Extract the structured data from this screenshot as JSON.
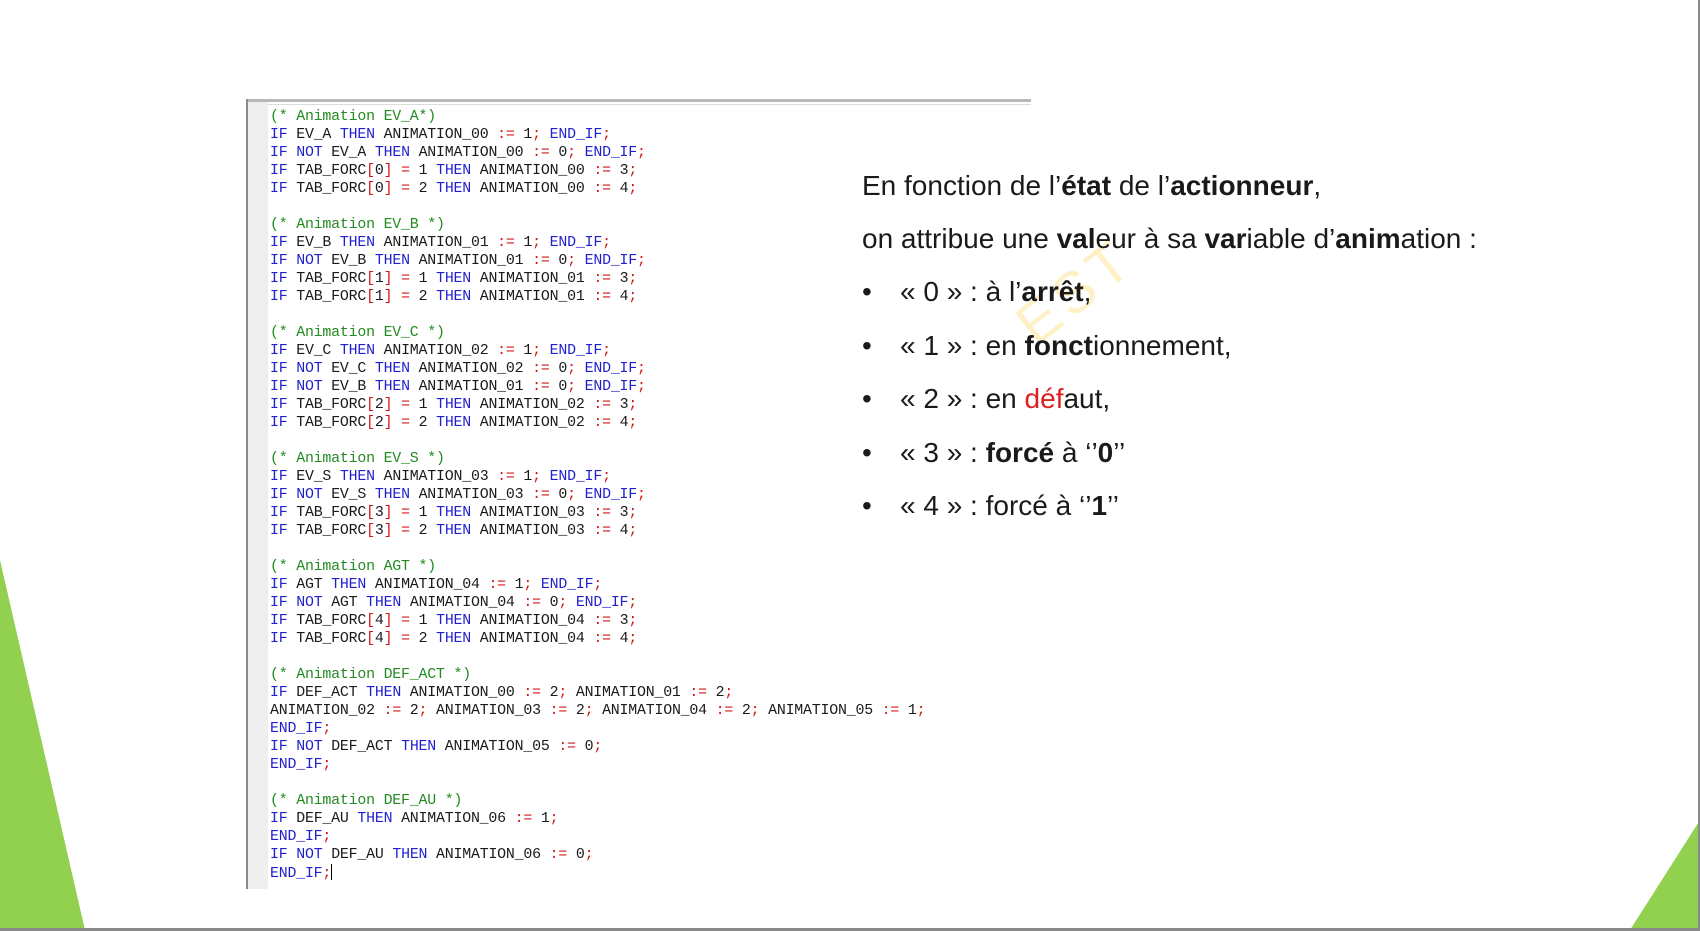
{
  "colors": {
    "keyword": "#1f1fd0",
    "operator": "#d01818",
    "comment": "#228b22",
    "accent_green": "#92d050",
    "defaut_red": "#e02020"
  },
  "code_lines": [
    [
      [
        "cm",
        "(* Animation EV_A*)"
      ]
    ],
    [
      [
        "kw",
        "IF"
      ],
      [
        "id",
        " EV_A "
      ],
      [
        "kw",
        "THEN"
      ],
      [
        "id",
        " ANIMATION_00 "
      ],
      [
        "op",
        ":="
      ],
      [
        "id",
        " 1"
      ],
      [
        "op",
        ";"
      ],
      [
        "id",
        " "
      ],
      [
        "kw",
        "END_IF"
      ],
      [
        "op",
        ";"
      ]
    ],
    [
      [
        "kw",
        "IF"
      ],
      [
        "id",
        " "
      ],
      [
        "kw",
        "NOT"
      ],
      [
        "id",
        " EV_A "
      ],
      [
        "kw",
        "THEN"
      ],
      [
        "id",
        " ANIMATION_00 "
      ],
      [
        "op",
        ":="
      ],
      [
        "id",
        " 0"
      ],
      [
        "op",
        ";"
      ],
      [
        "id",
        " "
      ],
      [
        "kw",
        "END_IF"
      ],
      [
        "op",
        ";"
      ]
    ],
    [
      [
        "kw",
        "IF"
      ],
      [
        "id",
        " TAB_FORC"
      ],
      [
        "op",
        "["
      ],
      [
        "id",
        "0"
      ],
      [
        "op",
        "]"
      ],
      [
        "id",
        " "
      ],
      [
        "op",
        "="
      ],
      [
        "id",
        " 1 "
      ],
      [
        "kw",
        "THEN"
      ],
      [
        "id",
        " ANIMATION_00 "
      ],
      [
        "op",
        ":="
      ],
      [
        "id",
        " 3"
      ],
      [
        "op",
        ";"
      ]
    ],
    [
      [
        "kw",
        "IF"
      ],
      [
        "id",
        " TAB_FORC"
      ],
      [
        "op",
        "["
      ],
      [
        "id",
        "0"
      ],
      [
        "op",
        "]"
      ],
      [
        "id",
        " "
      ],
      [
        "op",
        "="
      ],
      [
        "id",
        " 2 "
      ],
      [
        "kw",
        "THEN"
      ],
      [
        "id",
        " ANIMATION_00 "
      ],
      [
        "op",
        ":="
      ],
      [
        "id",
        " 4"
      ],
      [
        "op",
        ";"
      ]
    ],
    [],
    [
      [
        "cm",
        "(* Animation EV_B *)"
      ]
    ],
    [
      [
        "kw",
        "IF"
      ],
      [
        "id",
        " EV_B "
      ],
      [
        "kw",
        "THEN"
      ],
      [
        "id",
        " ANIMATION_01 "
      ],
      [
        "op",
        ":="
      ],
      [
        "id",
        " 1"
      ],
      [
        "op",
        ";"
      ],
      [
        "id",
        " "
      ],
      [
        "kw",
        "END_IF"
      ],
      [
        "op",
        ";"
      ]
    ],
    [
      [
        "kw",
        "IF"
      ],
      [
        "id",
        " "
      ],
      [
        "kw",
        "NOT"
      ],
      [
        "id",
        " EV_B "
      ],
      [
        "kw",
        "THEN"
      ],
      [
        "id",
        " ANIMATION_01 "
      ],
      [
        "op",
        ":="
      ],
      [
        "id",
        " 0"
      ],
      [
        "op",
        ";"
      ],
      [
        "id",
        " "
      ],
      [
        "kw",
        "END_IF"
      ],
      [
        "op",
        ";"
      ]
    ],
    [
      [
        "kw",
        "IF"
      ],
      [
        "id",
        " TAB_FORC"
      ],
      [
        "op",
        "["
      ],
      [
        "id",
        "1"
      ],
      [
        "op",
        "]"
      ],
      [
        "id",
        " "
      ],
      [
        "op",
        "="
      ],
      [
        "id",
        " 1 "
      ],
      [
        "kw",
        "THEN"
      ],
      [
        "id",
        " ANIMATION_01 "
      ],
      [
        "op",
        ":="
      ],
      [
        "id",
        " 3"
      ],
      [
        "op",
        ";"
      ]
    ],
    [
      [
        "kw",
        "IF"
      ],
      [
        "id",
        " TAB_FORC"
      ],
      [
        "op",
        "["
      ],
      [
        "id",
        "1"
      ],
      [
        "op",
        "]"
      ],
      [
        "id",
        " "
      ],
      [
        "op",
        "="
      ],
      [
        "id",
        " 2 "
      ],
      [
        "kw",
        "THEN"
      ],
      [
        "id",
        " ANIMATION_01 "
      ],
      [
        "op",
        ":="
      ],
      [
        "id",
        " 4"
      ],
      [
        "op",
        ";"
      ]
    ],
    [],
    [
      [
        "cm",
        "(* Animation EV_C *)"
      ]
    ],
    [
      [
        "kw",
        "IF"
      ],
      [
        "id",
        " EV_C "
      ],
      [
        "kw",
        "THEN"
      ],
      [
        "id",
        " ANIMATION_02 "
      ],
      [
        "op",
        ":="
      ],
      [
        "id",
        " 1"
      ],
      [
        "op",
        ";"
      ],
      [
        "id",
        " "
      ],
      [
        "kw",
        "END_IF"
      ],
      [
        "op",
        ";"
      ]
    ],
    [
      [
        "kw",
        "IF"
      ],
      [
        "id",
        " "
      ],
      [
        "kw",
        "NOT"
      ],
      [
        "id",
        " EV_C "
      ],
      [
        "kw",
        "THEN"
      ],
      [
        "id",
        " ANIMATION_02 "
      ],
      [
        "op",
        ":="
      ],
      [
        "id",
        " 0"
      ],
      [
        "op",
        ";"
      ],
      [
        "id",
        " "
      ],
      [
        "kw",
        "END_IF"
      ],
      [
        "op",
        ";"
      ]
    ],
    [
      [
        "kw",
        "IF"
      ],
      [
        "id",
        " "
      ],
      [
        "kw",
        "NOT"
      ],
      [
        "id",
        " EV_B "
      ],
      [
        "kw",
        "THEN"
      ],
      [
        "id",
        " ANIMATION_01 "
      ],
      [
        "op",
        ":="
      ],
      [
        "id",
        " 0"
      ],
      [
        "op",
        ";"
      ],
      [
        "id",
        " "
      ],
      [
        "kw",
        "END_IF"
      ],
      [
        "op",
        ";"
      ]
    ],
    [
      [
        "kw",
        "IF"
      ],
      [
        "id",
        " TAB_FORC"
      ],
      [
        "op",
        "["
      ],
      [
        "id",
        "2"
      ],
      [
        "op",
        "]"
      ],
      [
        "id",
        " "
      ],
      [
        "op",
        "="
      ],
      [
        "id",
        " 1 "
      ],
      [
        "kw",
        "THEN"
      ],
      [
        "id",
        " ANIMATION_02 "
      ],
      [
        "op",
        ":="
      ],
      [
        "id",
        " 3"
      ],
      [
        "op",
        ";"
      ]
    ],
    [
      [
        "kw",
        "IF"
      ],
      [
        "id",
        " TAB_FORC"
      ],
      [
        "op",
        "["
      ],
      [
        "id",
        "2"
      ],
      [
        "op",
        "]"
      ],
      [
        "id",
        " "
      ],
      [
        "op",
        "="
      ],
      [
        "id",
        " 2 "
      ],
      [
        "kw",
        "THEN"
      ],
      [
        "id",
        " ANIMATION_02 "
      ],
      [
        "op",
        ":="
      ],
      [
        "id",
        " 4"
      ],
      [
        "op",
        ";"
      ]
    ],
    [],
    [
      [
        "cm",
        "(* Animation EV_S *)"
      ]
    ],
    [
      [
        "kw",
        "IF"
      ],
      [
        "id",
        " EV_S "
      ],
      [
        "kw",
        "THEN"
      ],
      [
        "id",
        " ANIMATION_03 "
      ],
      [
        "op",
        ":="
      ],
      [
        "id",
        " 1"
      ],
      [
        "op",
        ";"
      ],
      [
        "id",
        " "
      ],
      [
        "kw",
        "END_IF"
      ],
      [
        "op",
        ";"
      ]
    ],
    [
      [
        "kw",
        "IF"
      ],
      [
        "id",
        " "
      ],
      [
        "kw",
        "NOT"
      ],
      [
        "id",
        " EV_S "
      ],
      [
        "kw",
        "THEN"
      ],
      [
        "id",
        " ANIMATION_03 "
      ],
      [
        "op",
        ":="
      ],
      [
        "id",
        " 0"
      ],
      [
        "op",
        ";"
      ],
      [
        "id",
        " "
      ],
      [
        "kw",
        "END_IF"
      ],
      [
        "op",
        ";"
      ]
    ],
    [
      [
        "kw",
        "IF"
      ],
      [
        "id",
        " TAB_FORC"
      ],
      [
        "op",
        "["
      ],
      [
        "id",
        "3"
      ],
      [
        "op",
        "]"
      ],
      [
        "id",
        " "
      ],
      [
        "op",
        "="
      ],
      [
        "id",
        " 1 "
      ],
      [
        "kw",
        "THEN"
      ],
      [
        "id",
        " ANIMATION_03 "
      ],
      [
        "op",
        ":="
      ],
      [
        "id",
        " 3"
      ],
      [
        "op",
        ";"
      ]
    ],
    [
      [
        "kw",
        "IF"
      ],
      [
        "id",
        " TAB_FORC"
      ],
      [
        "op",
        "["
      ],
      [
        "id",
        "3"
      ],
      [
        "op",
        "]"
      ],
      [
        "id",
        " "
      ],
      [
        "op",
        "="
      ],
      [
        "id",
        " 2 "
      ],
      [
        "kw",
        "THEN"
      ],
      [
        "id",
        " ANIMATION_03 "
      ],
      [
        "op",
        ":="
      ],
      [
        "id",
        " 4"
      ],
      [
        "op",
        ";"
      ]
    ],
    [],
    [
      [
        "cm",
        "(* Animation AGT *)"
      ]
    ],
    [
      [
        "kw",
        "IF"
      ],
      [
        "id",
        " AGT "
      ],
      [
        "kw",
        "THEN"
      ],
      [
        "id",
        " ANIMATION_04 "
      ],
      [
        "op",
        ":="
      ],
      [
        "id",
        " 1"
      ],
      [
        "op",
        ";"
      ],
      [
        "id",
        " "
      ],
      [
        "kw",
        "END_IF"
      ],
      [
        "op",
        ";"
      ]
    ],
    [
      [
        "kw",
        "IF"
      ],
      [
        "id",
        " "
      ],
      [
        "kw",
        "NOT"
      ],
      [
        "id",
        " AGT "
      ],
      [
        "kw",
        "THEN"
      ],
      [
        "id",
        " ANIMATION_04 "
      ],
      [
        "op",
        ":="
      ],
      [
        "id",
        " 0"
      ],
      [
        "op",
        ";"
      ],
      [
        "id",
        " "
      ],
      [
        "kw",
        "END_IF"
      ],
      [
        "op",
        ";"
      ]
    ],
    [
      [
        "kw",
        "IF"
      ],
      [
        "id",
        " TAB_FORC"
      ],
      [
        "op",
        "["
      ],
      [
        "id",
        "4"
      ],
      [
        "op",
        "]"
      ],
      [
        "id",
        " "
      ],
      [
        "op",
        "="
      ],
      [
        "id",
        " 1 "
      ],
      [
        "kw",
        "THEN"
      ],
      [
        "id",
        " ANIMATION_04 "
      ],
      [
        "op",
        ":="
      ],
      [
        "id",
        " 3"
      ],
      [
        "op",
        ";"
      ]
    ],
    [
      [
        "kw",
        "IF"
      ],
      [
        "id",
        " TAB_FORC"
      ],
      [
        "op",
        "["
      ],
      [
        "id",
        "4"
      ],
      [
        "op",
        "]"
      ],
      [
        "id",
        " "
      ],
      [
        "op",
        "="
      ],
      [
        "id",
        " 2 "
      ],
      [
        "kw",
        "THEN"
      ],
      [
        "id",
        " ANIMATION_04 "
      ],
      [
        "op",
        ":="
      ],
      [
        "id",
        " 4"
      ],
      [
        "op",
        ";"
      ]
    ],
    [],
    [
      [
        "cm",
        "(* Animation DEF_ACT *)"
      ]
    ],
    [
      [
        "kw",
        "IF"
      ],
      [
        "id",
        " DEF_ACT "
      ],
      [
        "kw",
        "THEN"
      ],
      [
        "id",
        " ANIMATION_00 "
      ],
      [
        "op",
        ":="
      ],
      [
        "id",
        " 2"
      ],
      [
        "op",
        ";"
      ],
      [
        "id",
        " ANIMATION_01 "
      ],
      [
        "op",
        ":="
      ],
      [
        "id",
        " 2"
      ],
      [
        "op",
        ";"
      ]
    ],
    [
      [
        "id",
        "ANIMATION_02 "
      ],
      [
        "op",
        ":="
      ],
      [
        "id",
        " 2"
      ],
      [
        "op",
        ";"
      ],
      [
        "id",
        " ANIMATION_03 "
      ],
      [
        "op",
        ":="
      ],
      [
        "id",
        " 2"
      ],
      [
        "op",
        ";"
      ],
      [
        "id",
        " ANIMATION_04 "
      ],
      [
        "op",
        ":="
      ],
      [
        "id",
        " 2"
      ],
      [
        "op",
        ";"
      ],
      [
        "id",
        " ANIMATION_05 "
      ],
      [
        "op",
        ":="
      ],
      [
        "id",
        " 1"
      ],
      [
        "op",
        ";"
      ]
    ],
    [
      [
        "kw",
        "END_IF"
      ],
      [
        "op",
        ";"
      ]
    ],
    [
      [
        "kw",
        "IF"
      ],
      [
        "id",
        " "
      ],
      [
        "kw",
        "NOT"
      ],
      [
        "id",
        " DEF_ACT "
      ],
      [
        "kw",
        "THEN"
      ],
      [
        "id",
        " ANIMATION_05 "
      ],
      [
        "op",
        ":="
      ],
      [
        "id",
        " 0"
      ],
      [
        "op",
        ";"
      ]
    ],
    [
      [
        "kw",
        "END_IF"
      ],
      [
        "op",
        ";"
      ]
    ],
    [],
    [
      [
        "cm",
        "(* Animation DEF_AU *)"
      ]
    ],
    [
      [
        "kw",
        "IF"
      ],
      [
        "id",
        " DEF_AU "
      ],
      [
        "kw",
        "THEN"
      ],
      [
        "id",
        " ANIMATION_06 "
      ],
      [
        "op",
        ":="
      ],
      [
        "id",
        " 1"
      ],
      [
        "op",
        ";"
      ]
    ],
    [
      [
        "kw",
        "END_IF"
      ],
      [
        "op",
        ";"
      ]
    ],
    [
      [
        "kw",
        "IF"
      ],
      [
        "id",
        " "
      ],
      [
        "kw",
        "NOT"
      ],
      [
        "id",
        " DEF_AU "
      ],
      [
        "kw",
        "THEN"
      ],
      [
        "id",
        " ANIMATION_06 "
      ],
      [
        "op",
        ":="
      ],
      [
        "id",
        " 0"
      ],
      [
        "op",
        ";"
      ]
    ],
    [
      [
        "kw",
        "END_IF"
      ],
      [
        "op",
        ";"
      ]
    ]
  ],
  "explanation": {
    "line1": [
      [
        "n",
        "En fonction de l’"
      ],
      [
        "b",
        "état"
      ],
      [
        "n",
        " de l’"
      ],
      [
        "b",
        "actionneur"
      ],
      [
        "n",
        ","
      ]
    ],
    "line2": [
      [
        "n",
        "on attribue une "
      ],
      [
        "b",
        "val"
      ],
      [
        "n",
        "eur à sa "
      ],
      [
        "b",
        "var"
      ],
      [
        "n",
        "iable d’"
      ],
      [
        "b",
        "anim"
      ],
      [
        "n",
        "ation :"
      ]
    ],
    "bullet_symbol": "•",
    "bullets": [
      [
        [
          "n",
          "« 0 » : à l’"
        ],
        [
          "b",
          "arrêt"
        ],
        [
          "n",
          ","
        ]
      ],
      [
        [
          "n",
          "« 1 » : en "
        ],
        [
          "b",
          "fonct"
        ],
        [
          "n",
          "ionnement,"
        ]
      ],
      [
        [
          "n",
          "« 2 » : en "
        ],
        [
          "r",
          "déf"
        ],
        [
          "n",
          "aut,"
        ]
      ],
      [
        [
          "n",
          "« 3 » : "
        ],
        [
          "b",
          "forcé"
        ],
        [
          "n",
          " à ‘’"
        ],
        [
          "b",
          "0"
        ],
        [
          "n",
          "’’"
        ]
      ],
      [
        [
          "n",
          "« 4 » : forcé à ‘’"
        ],
        [
          "b",
          "1"
        ],
        [
          "n",
          "’’"
        ]
      ]
    ]
  },
  "watermark": "EST"
}
